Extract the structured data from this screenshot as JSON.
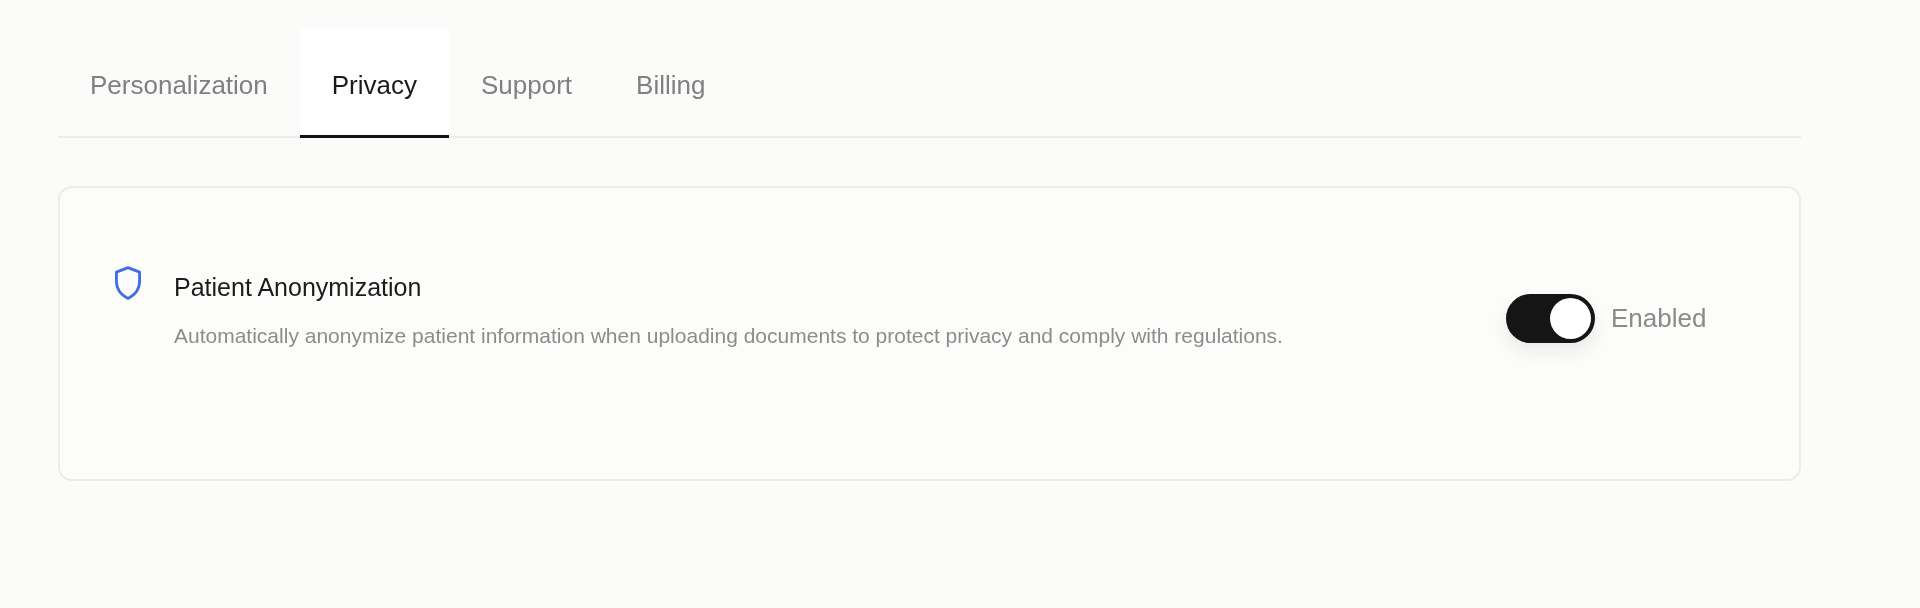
{
  "tabs": [
    {
      "label": "Personalization",
      "selected": false
    },
    {
      "label": "Privacy",
      "selected": true
    },
    {
      "label": "Support",
      "selected": false
    },
    {
      "label": "Billing",
      "selected": false
    }
  ],
  "setting": {
    "title": "Patient Anonymization",
    "description": "Automatically anonymize patient information when uploading documents to protect privacy and comply with regulations.",
    "on": true,
    "status": "Enabled"
  }
}
